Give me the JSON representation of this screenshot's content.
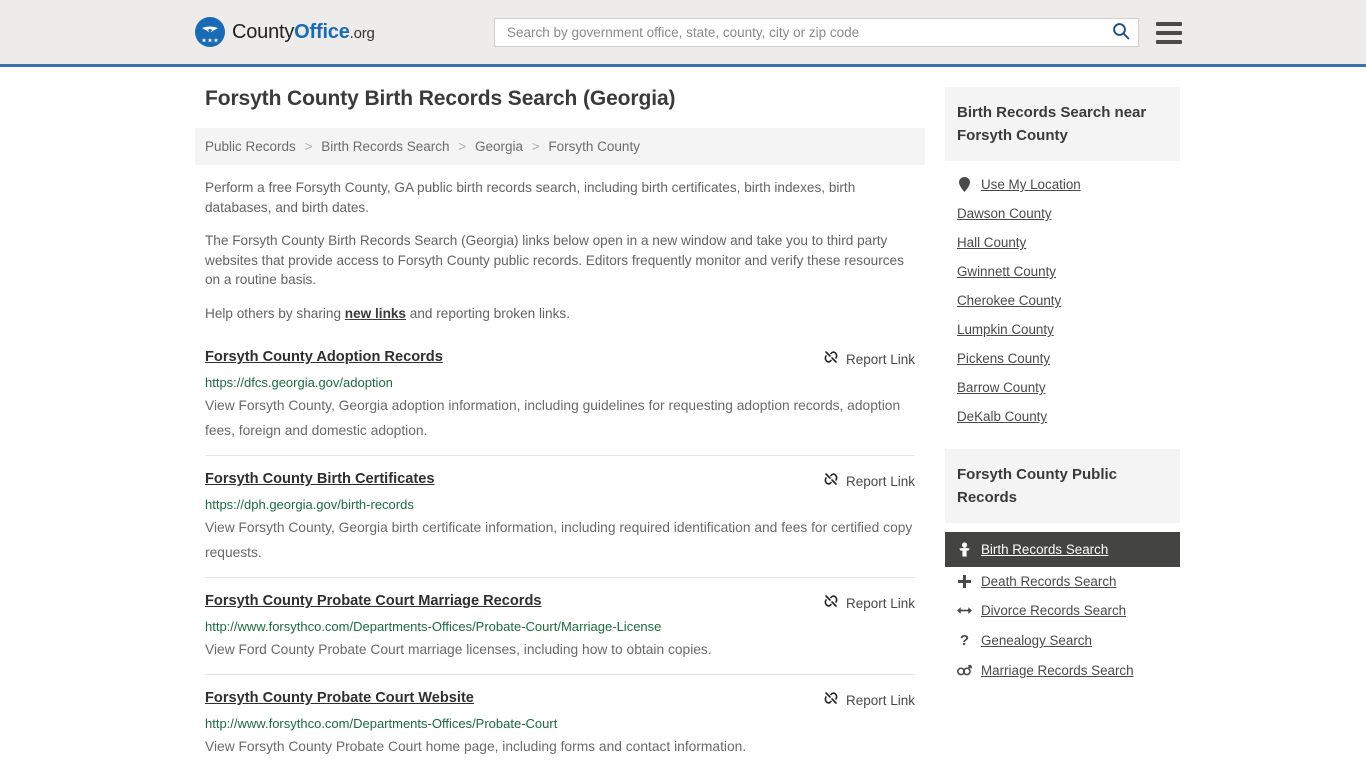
{
  "header": {
    "logo": {
      "icon": "eagle-seal-icon",
      "text_primary": "County",
      "text_accent": "Office",
      "text_suffix": ".org"
    },
    "search": {
      "placeholder": "Search by government office, state, county, city or zip code",
      "value": "",
      "search_icon": "search-icon"
    },
    "menu_icon": "hamburger-menu-icon",
    "accent_color": "#3b73a8",
    "background_color": "#edecea"
  },
  "page_title": "Forsyth County Birth Records Search (Georgia)",
  "breadcrumb": {
    "separator": ">",
    "items": [
      {
        "label": "Public Records"
      },
      {
        "label": "Birth Records Search"
      },
      {
        "label": "Georgia"
      },
      {
        "label": "Forsyth County"
      }
    ]
  },
  "intro": {
    "paragraph1": "Perform a free Forsyth County, GA public birth records search, including birth certificates, birth indexes, birth databases, and birth dates.",
    "paragraph2": "The Forsyth County Birth Records Search (Georgia) links below open in a new window and take you to third party websites that provide access to Forsyth County public records. Editors frequently monitor and verify these resources on a routine basis.",
    "paragraph3_prefix": "Help others by sharing ",
    "paragraph3_link": "new links",
    "paragraph3_suffix": " and reporting broken links."
  },
  "report_link": {
    "label": "Report Link",
    "icon": "broken-link-icon"
  },
  "results": [
    {
      "title": "Forsyth County Adoption Records",
      "url": "https://dfcs.georgia.gov/adoption",
      "description": "View Forsyth County, Georgia adoption information, including guidelines for requesting adoption records, adoption fees, foreign and domestic adoption."
    },
    {
      "title": "Forsyth County Birth Certificates",
      "url": "https://dph.georgia.gov/birth-records",
      "description": "View Forsyth County, Georgia birth certificate information, including required identification and fees for certified copy requests."
    },
    {
      "title": "Forsyth County Probate Court Marriage Records",
      "url": "http://www.forsythco.com/Departments-Offices/Probate-Court/Marriage-License",
      "description": "View Ford County Probate Court marriage licenses, including how to obtain copies."
    },
    {
      "title": "Forsyth County Probate Court Website",
      "url": "http://www.forsythco.com/Departments-Offices/Probate-Court",
      "description": "View Forsyth County Probate Court home page, including forms and contact information."
    }
  ],
  "sidebar": {
    "nearby": {
      "heading": "Birth Records Search near Forsyth County",
      "items": [
        {
          "label": "Use My Location",
          "icon": "map-pin-icon"
        },
        {
          "label": "Dawson County",
          "icon": ""
        },
        {
          "label": "Hall County",
          "icon": ""
        },
        {
          "label": "Gwinnett County",
          "icon": ""
        },
        {
          "label": "Cherokee County",
          "icon": ""
        },
        {
          "label": "Lumpkin County",
          "icon": ""
        },
        {
          "label": "Pickens County",
          "icon": ""
        },
        {
          "label": "Barrow County",
          "icon": ""
        },
        {
          "label": "DeKalb County",
          "icon": ""
        }
      ]
    },
    "public_records": {
      "heading": "Forsyth County Public Records",
      "items": [
        {
          "label": "Birth Records Search",
          "icon": "baby-icon",
          "active": true
        },
        {
          "label": "Death Records Search",
          "icon": "cross-icon",
          "active": false
        },
        {
          "label": "Divorce Records Search",
          "icon": "left-right-arrow-icon",
          "active": false
        },
        {
          "label": "Genealogy Search",
          "icon": "question-mark-icon",
          "active": false
        },
        {
          "label": "Marriage Records Search",
          "icon": "male-female-icon",
          "active": false
        }
      ]
    },
    "active_background_color": "#444442"
  }
}
